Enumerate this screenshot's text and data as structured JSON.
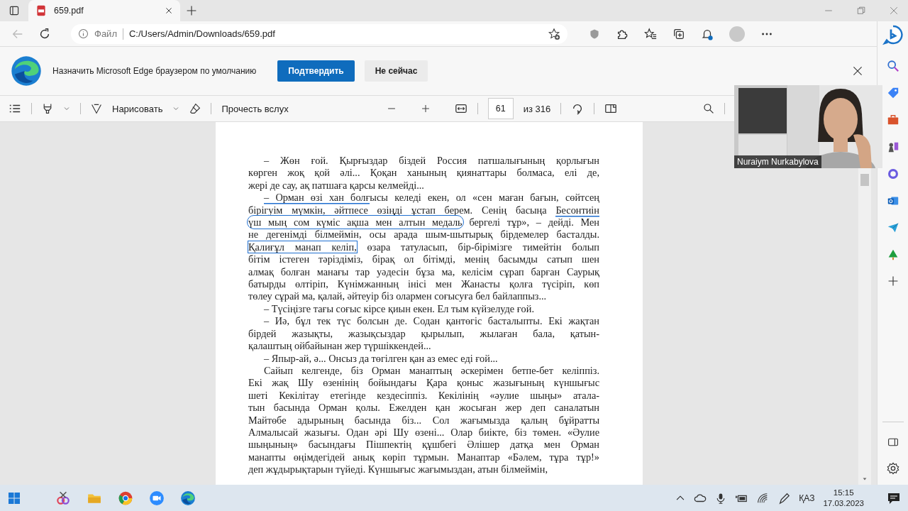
{
  "browser": {
    "tab": {
      "title": "659.pdf",
      "selected": true
    },
    "back": {
      "disabled": true
    },
    "address": {
      "scheme_label": "Файл",
      "url": "C:/Users/Admin/Downloads/659.pdf"
    }
  },
  "infobar": {
    "message": "Назначить Microsoft Edge браузером по умолчанию",
    "buttons": [
      {
        "label": "Подтвердить",
        "kind": "primary"
      },
      {
        "label": "Не сейчас",
        "kind": "secondary"
      }
    ]
  },
  "pdf_toolbar": {
    "draw_label": "Нарисовать",
    "read_aloud_label": "Прочесть вслух",
    "page": "61",
    "page_total": "из 316"
  },
  "document": {
    "paragraphs": [
      {
        "lines": [
          "– Жөн ғой. Қырғыздар біздей Россия патшалығының қорлығын",
          "көрген жоқ қой әлі... Қоқан ханының қиянаттары болмаса, елі де,",
          "жері де сау, ақ патшаға қарсы келмейді..."
        ]
      },
      {
        "lines": [
          {
            "segments": [
              {
                "text": "– Орман өзі хан болғ",
                "kind": "underline"
              },
              {
                "text": "ысы келеді екен, ол «сен маған бағын, сөйтсең",
                "kind": "plain"
              }
            ]
          },
          {
            "segments": [
              {
                "text": "бірігуім мүмкін, әйтпесе өзіңді ұстап берем. Сенің басыңа ",
                "kind": "plain"
              },
              {
                "text": "Бесонтиін",
                "kind": "underline"
              }
            ]
          },
          {
            "segments": [
              {
                "text": "үш мың сом күміс ақша мен алтын медаль",
                "kind": "loop"
              },
              {
                "text": " бергелі тұр», – дейді. Мен",
                "kind": "plain"
              }
            ]
          },
          "не дегенімді білмеймін, осы арада шым-шытырық бірдемелер басталды.",
          {
            "segments": [
              {
                "text": "Қалиғұл манап келіп,",
                "kind": "box"
              },
              {
                "text": " өзара татуласып, бір-бірімізге тимейтін болып",
                "kind": "plain"
              }
            ]
          },
          "бітім істеген тәріздіміз, бірақ ол бітімді, менің басымды сатып шен",
          "алмақ болған манағы тар уәдесін бұза ма, келісім сұрап барған Саурық",
          "батырды өлтіріп, Күнімжанның інісі мен Жанасты қолға түсіріп, көп",
          "төлеу сұрай ма, қалай, әйтеуір біз олармен соғысуға бел байлаппыз..."
        ]
      },
      {
        "lines": [
          "– Түсіңізге тағы соғыс кірсе қиын екен. Ел тым күйзелуде ғой."
        ]
      },
      {
        "lines": [
          "– Иә, бұл тек түс болсын де. Содан қантөгіс басталыпты. Екі жақтан",
          "бірдей жазықты, жазықсыздар қырылып, жылаған бала, қатын-",
          "қалаштың ойбайынан жер түршіккендей..."
        ]
      },
      {
        "lines": [
          "– Япыр-ай, ә... Онсыз да төгілген қан аз емес еді ғой..."
        ]
      },
      {
        "lines": [
          "Сайып келгенде, біз Орман манаптың әскерімен бетпе-бет келіппіз.",
          "Екі жақ Шу өзенінің бойындағы Қара қоныс жазығының күншығыс",
          "шеті Кекілітау етегінде кездесіппіз. Кекілінің «әулие шыңы» атала-",
          "тын басында Орман қолы. Ежелден қан жосыған жер деп саналатын",
          "Майтөбе адырының басында біз... Сол жағымызда қалың бұйратты",
          "Алмалысай жазығы. Одан әрі Шу өзені... Олар биікте, біз төмен. «Әулие",
          "шыңының» басындағы Пішпектің құшбегі Әлішер датқа мен Орман",
          "манапты өңімдегідей анық көріп тұрмын. Манаптар «Бәлем, тұра тұр!»",
          "деп жұдырықтарын түйеді. Күншығыс жағымыздан, атын білмеймін,"
        ]
      }
    ]
  },
  "video": {
    "participant": "Nuraiym Nurkabylova"
  },
  "taskbar": {
    "language": "ҚАЗ",
    "time": "15:15",
    "date": "17.03.2023"
  }
}
